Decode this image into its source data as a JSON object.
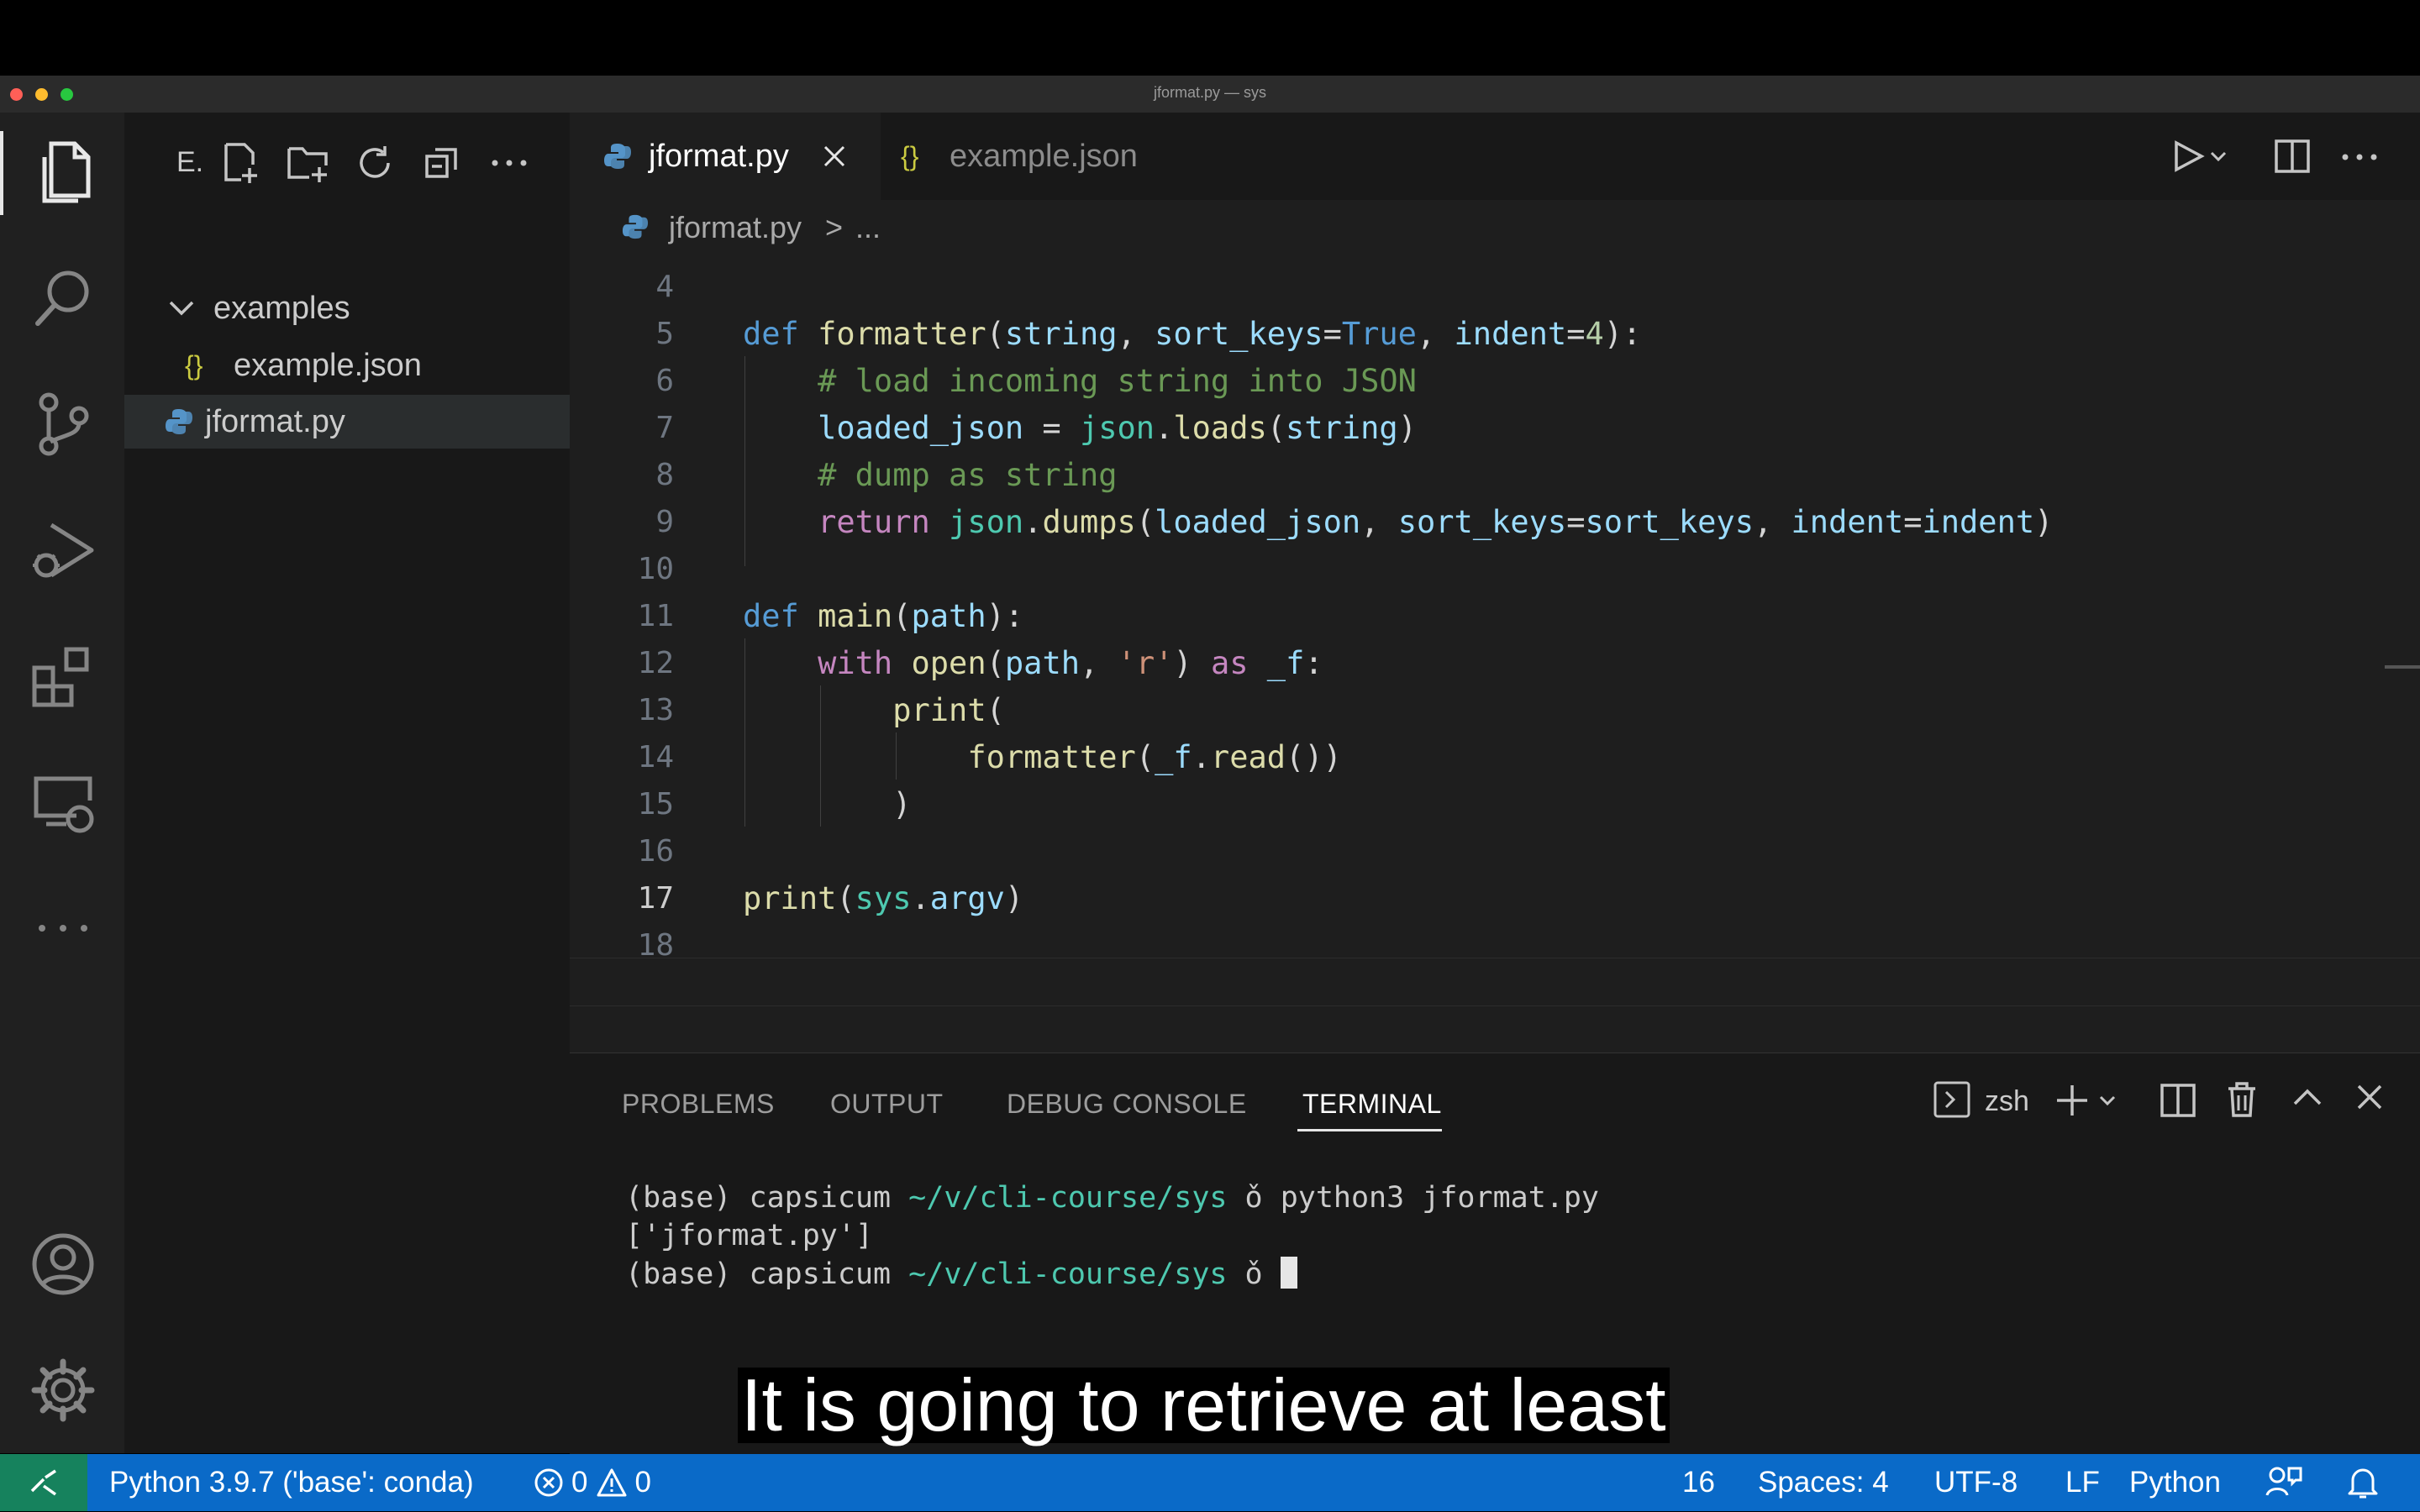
{
  "window": {
    "title": "jformat.py — sys"
  },
  "sidebar": {
    "header_abbrev": "E.",
    "tree": [
      {
        "label": "examples",
        "type": "folder"
      },
      {
        "label": "example.json",
        "type": "json",
        "icon_text": "{}"
      },
      {
        "label": "jformat.py",
        "type": "python",
        "selected": true
      }
    ]
  },
  "editor": {
    "tabs": [
      {
        "label": "jformat.py",
        "active": true
      },
      {
        "label": "example.json",
        "icon_text": "{}"
      }
    ],
    "breadcrumb": {
      "file": "jformat.py",
      "sep": ">",
      "rest": "..."
    },
    "line_numbers": [
      "4",
      "5",
      "6",
      "7",
      "8",
      "9",
      "10",
      "11",
      "12",
      "13",
      "14",
      "15",
      "16",
      "17",
      "18"
    ],
    "current_line": "17"
  },
  "panel": {
    "tabs": [
      "PROBLEMS",
      "OUTPUT",
      "DEBUG CONSOLE",
      "TERMINAL"
    ],
    "active_tab": "TERMINAL",
    "shell": "zsh",
    "terminal": {
      "line1": {
        "env": "(base)",
        "user": "capsicum",
        "path": "~/v/cli-course/sys",
        "prompt": "ǒ",
        "cmd": "python3 jformat.py"
      },
      "line2": "['jformat.py']",
      "line3": {
        "env": "(base)",
        "user": "capsicum",
        "path": "~/v/cli-course/sys",
        "prompt": "ǒ"
      }
    }
  },
  "statusbar": {
    "interpreter": "Python 3.9.7 ('base': conda)",
    "errors": "0",
    "warnings": "0",
    "partial_position": "16",
    "spaces": "Spaces: 4",
    "encoding": "UTF-8",
    "eol": "LF",
    "language": "Python",
    "color": "#0a6ac8"
  },
  "caption": "It is going to retrieve at least"
}
